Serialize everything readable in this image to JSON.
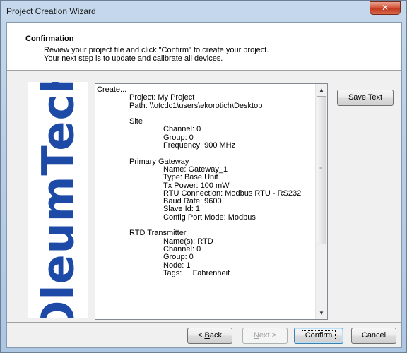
{
  "window": {
    "title": "Project Creation Wizard",
    "close_glyph": "✕",
    "accent": "#c23b22"
  },
  "header": {
    "title": "Confirmation",
    "line1": "Review your project file and click \"Confirm\" to create your project.",
    "line2": "Your next step is to update and calibrate all devices."
  },
  "logo": {
    "text": "OleumTech",
    "color": "#1d49a7"
  },
  "summary": {
    "lines": [
      {
        "indent": 0,
        "text": "Create..."
      },
      {
        "indent": 1,
        "text": "Project: My Project"
      },
      {
        "indent": 1,
        "text": "Path: \\\\otcdc1\\users\\ekorotich\\Desktop"
      },
      {
        "indent": 0,
        "text": ""
      },
      {
        "indent": 1,
        "text": "Site"
      },
      {
        "indent": 2,
        "text": "Channel: 0"
      },
      {
        "indent": 2,
        "text": "Group: 0"
      },
      {
        "indent": 2,
        "text": "Frequency: 900 MHz"
      },
      {
        "indent": 0,
        "text": ""
      },
      {
        "indent": 1,
        "text": "Primary Gateway"
      },
      {
        "indent": 2,
        "text": "Name: Gateway_1"
      },
      {
        "indent": 2,
        "text": "Type: Base Unit"
      },
      {
        "indent": 2,
        "text": "Tx Power: 100 mW"
      },
      {
        "indent": 2,
        "text": "RTU Connection: Modbus RTU - RS232"
      },
      {
        "indent": 2,
        "text": "Baud Rate: 9600"
      },
      {
        "indent": 2,
        "text": "Slave Id: 1"
      },
      {
        "indent": 2,
        "text": "Config Port Mode: Modbus"
      },
      {
        "indent": 0,
        "text": ""
      },
      {
        "indent": 1,
        "text": "RTD Transmitter"
      },
      {
        "indent": 2,
        "text": "Name(s): RTD"
      },
      {
        "indent": 2,
        "text": "Channel: 0"
      },
      {
        "indent": 2,
        "text": "Group: 0"
      },
      {
        "indent": 2,
        "text": "Node: 1"
      },
      {
        "indent": 2,
        "text": "Tags:     Fahrenheit"
      }
    ]
  },
  "buttons": {
    "save_text": "Save Text",
    "back_prefix": "< ",
    "back_underline": "B",
    "back_rest": "ack",
    "next_underline": "N",
    "next_rest": "ext >",
    "confirm": "Confirm",
    "cancel": "Cancel"
  }
}
